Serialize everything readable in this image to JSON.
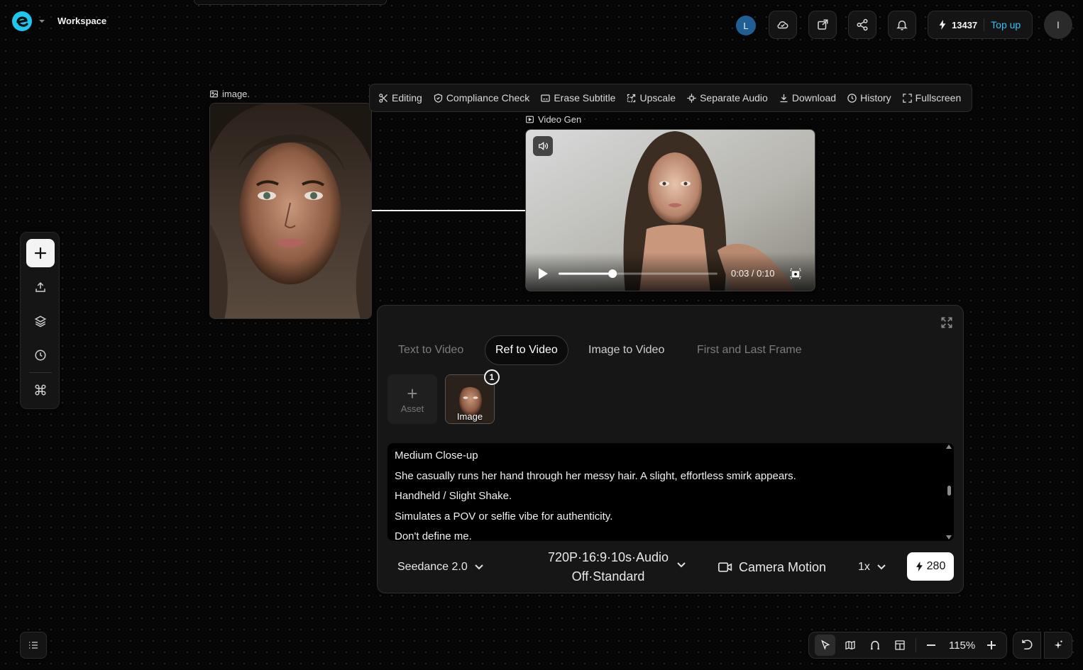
{
  "app": {
    "workspace_title": "Workspace"
  },
  "header": {
    "avatar_initial": "L",
    "credits": "13437",
    "top_up_label": "Top up",
    "user_initial": "I",
    "icons": [
      "cloud-icon",
      "external-link-icon",
      "share-icon",
      "bell-icon",
      "bolt-icon"
    ]
  },
  "left_toolbar": {
    "icons": [
      "plus-icon",
      "upload-icon",
      "layers-icon",
      "clock-icon",
      "command-icon"
    ]
  },
  "image_node": {
    "label": "image."
  },
  "node_toolbar": {
    "items": [
      "Editing",
      "Compliance Check",
      "Erase Subtitle",
      "Upscale",
      "Separate Audio",
      "Download",
      "History",
      "Fullscreen"
    ]
  },
  "video_node": {
    "label": "Video Gen",
    "time": "0:03 / 0:10",
    "progress": 0.34
  },
  "gen_panel": {
    "tabs": [
      "Text to Video",
      "Ref to Video",
      "Image to Video",
      "First and Last Frame"
    ],
    "active_tab": "Ref to Video",
    "asset_add_label": "Asset",
    "asset_image_label": "Image",
    "asset_badge": "1",
    "prompt_lines": [
      "Medium Close-up",
      "She casually runs her hand through her messy hair. A slight, effortless smirk appears.",
      "Handheld / Slight Shake.",
      "Simulates a POV or selfie vibe for authenticity.",
      "Don't define me."
    ],
    "model": "Seedance 2.0",
    "settings_line1": "720P·16:9·10s·Audio",
    "settings_line2": "Off·Standard",
    "camera_label": "Camera Motion",
    "speed": "1x",
    "cost": "280"
  },
  "canvas_controls": {
    "zoom": "115%"
  },
  "colors": {
    "accent": "#35c2f2",
    "avatar_bg": "#1f5f95"
  }
}
